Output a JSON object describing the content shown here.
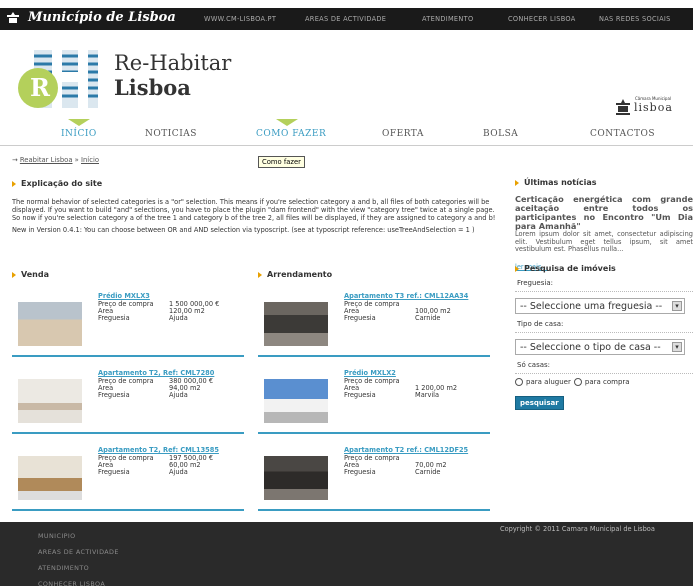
{
  "topbar": {
    "brand": "Município de Lisboa",
    "links": [
      "WWW.CM-LISBOA.PT",
      "AREAS DE ACTIVIDADE",
      "ATENDIMENTO",
      "CONHECER LISBOA",
      "NAS REDES SOCIAIS"
    ]
  },
  "logo": {
    "line1": "Re-Habitar",
    "line2": "Lisboa",
    "cml_small": "Câmara Municipal",
    "cml_name": "lisboa"
  },
  "nav": {
    "items": [
      "INÍCIO",
      "NOTICIAS",
      "COMO FAZER",
      "OFERTA",
      "BOLSA",
      "CONTACTOS"
    ],
    "tooltip": "Como fazer"
  },
  "breadcrumb": {
    "arrow": "→",
    "root": "Reabitar Lisboa",
    "sep": "»",
    "current": "Início"
  },
  "intro": {
    "title": "Explicação do site",
    "p1": "The normal behavior of selected categories is a \"or\" selection. This means if you're selection category a and b, all files of both categories will be displayed. If you want to build \"and\" selections, you have to place the plugin \"dam frontend\" with the view \"category tree\" twice at a single page. So now if you're selection category a of the tree 1 and category b of the tree 2, all files will be displayed, if they are assigned to category a and b!",
    "p2": "New in Version 0.4.1: You can choose between OR and AND selection via typoscript. (see at typoscript reference: useTreeAndSelection = 1 )"
  },
  "venda": {
    "title": "Venda",
    "cards": [
      {
        "title": "Prédio MXLX3",
        "labels": [
          "Preço de compra",
          "Area",
          "Freguesia"
        ],
        "values": [
          "1 500 000,00 €",
          "120,00 m2",
          "Ajuda"
        ]
      },
      {
        "title": "Apartamento T2, Ref: CML7280",
        "labels": [
          "Preço de compra",
          "Area",
          "Freguesia"
        ],
        "values": [
          "380 000,00 €",
          "94,00 m2",
          "Ajuda"
        ]
      },
      {
        "title": "Apartamento T2, Ref: CML13585",
        "labels": [
          "Preço de compra",
          "Area",
          "Freguesia"
        ],
        "values": [
          "197 500,00 €",
          "60,00 m2",
          "Ajuda"
        ]
      }
    ]
  },
  "arrendamento": {
    "title": "Arrendamento",
    "cards": [
      {
        "title": "Apartamento T3 ref.: CML12AA34",
        "labels": [
          "Preço de compra",
          "Area",
          "Freguesia"
        ],
        "values": [
          "",
          "100,00 m2",
          "Carnide"
        ]
      },
      {
        "title": "Prédio MXLX2",
        "labels": [
          "Preço de compra",
          "Area",
          "Freguesia"
        ],
        "values": [
          "",
          "1 200,00 m2",
          "Marvila"
        ]
      },
      {
        "title": "Apartamento T2 ref.: CML12DF25",
        "labels": [
          "Preço de compra",
          "Area",
          "Freguesia"
        ],
        "values": [
          "",
          "70,00 m2",
          "Carnide"
        ]
      }
    ]
  },
  "news": {
    "title": "Últimas notícias",
    "lead": "Certicação energética com grande aceitação entre todos os participantes no Encontro \"Um Dia para Amanhã\"",
    "body": "Lorem ipsum dolor sit amet, consectetur adipiscing elit. Vestibulum eget tellus ipsum, sit amet vestibulum est. Phasellus nulla...",
    "more": "ler mais..."
  },
  "search": {
    "title": "Pesquisa de imóveis",
    "freguesia_label": "Freguesia:",
    "freguesia_value": "-- Seleccione uma freguesia --",
    "tipo_label": "Tipo de casa:",
    "tipo_value": "-- Seleccione o tipo de casa --",
    "so_label": "Só casas:",
    "radio1": "para aluguer",
    "radio2": "para compra",
    "button": "pesquisar"
  },
  "footer": {
    "links": [
      "MUNICIPIO",
      "AREAS DE ACTIVIDADE",
      "ATENDIMENTO",
      "CONHECER LISBOA"
    ],
    "copyright": "Copyright © 2011 Camara Municipal de Lisboa"
  },
  "colors": {
    "accent": "#3a9cc2",
    "green": "#b4d05b",
    "orange": "#e8a000",
    "dark": "#1a1a1a"
  }
}
